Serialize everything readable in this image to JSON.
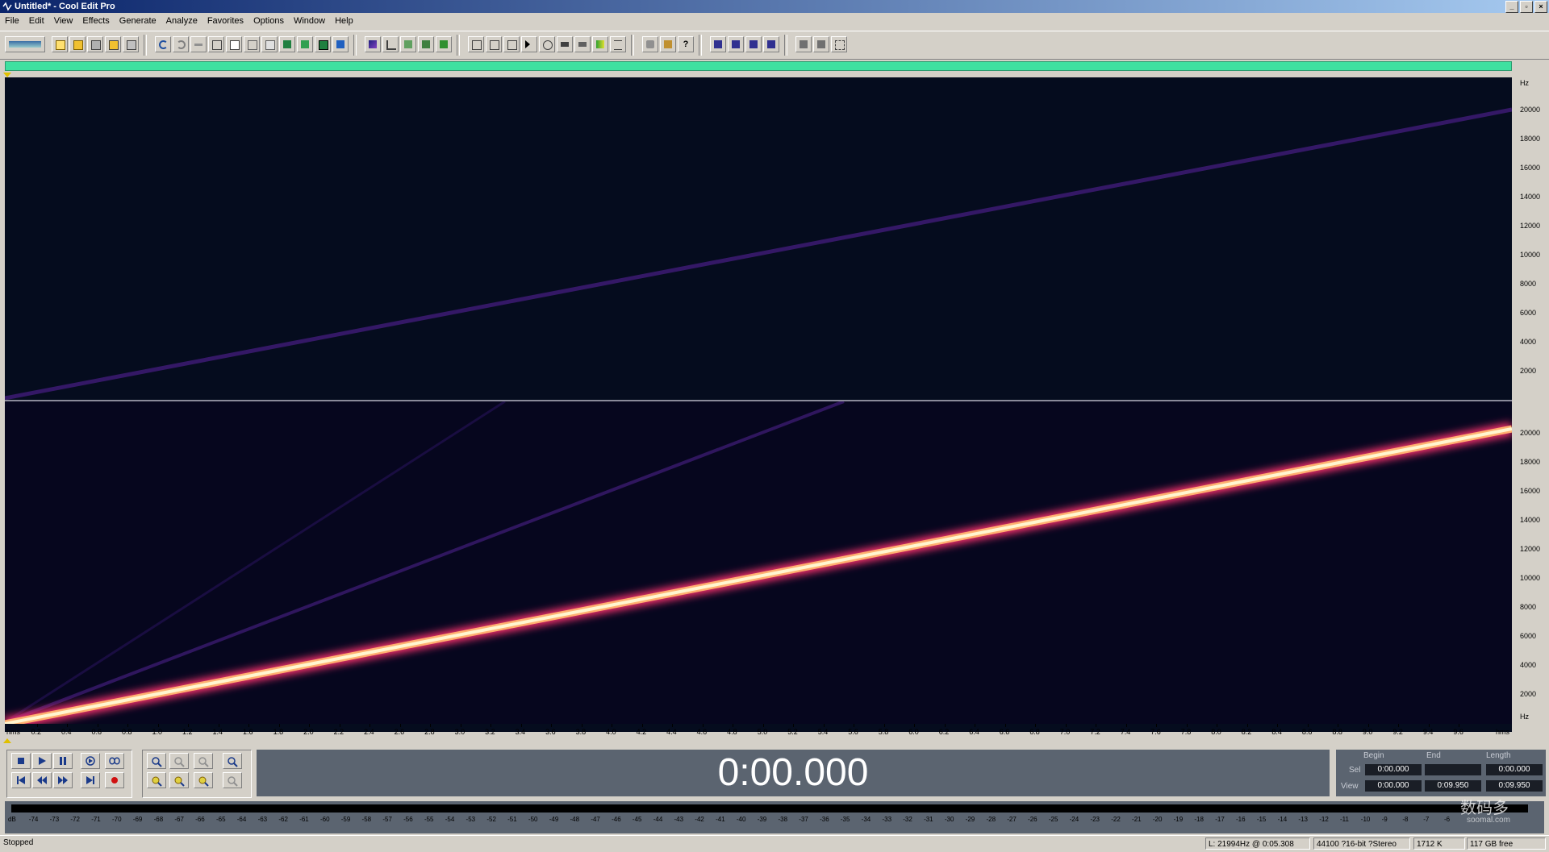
{
  "window": {
    "title": "Untitled* - Cool Edit Pro",
    "buttons": [
      "_",
      "▫",
      "×"
    ]
  },
  "menu": [
    "File",
    "Edit",
    "View",
    "Effects",
    "Generate",
    "Analyze",
    "Favorites",
    "Options",
    "Window",
    "Help"
  ],
  "freq_ruler": {
    "top": {
      "unit": "Hz",
      "labels": [
        "20000",
        "18000",
        "16000",
        "14000",
        "12000",
        "10000",
        "8000",
        "6000",
        "4000",
        "2000"
      ]
    },
    "bottom": {
      "unit": "Hz",
      "labels": [
        "20000",
        "18000",
        "16000",
        "14000",
        "12000",
        "10000",
        "8000",
        "6000",
        "4000",
        "2000"
      ]
    }
  },
  "time_ruler": {
    "start_label": "hms",
    "end_label": "hms",
    "labels": [
      "0.2",
      "0.4",
      "0.6",
      "0.8",
      "1.0",
      "1.2",
      "1.4",
      "1.6",
      "1.8",
      "2.0",
      "2.2",
      "2.4",
      "2.6",
      "2.8",
      "3.0",
      "3.2",
      "3.4",
      "3.6",
      "3.8",
      "4.0",
      "4.2",
      "4.4",
      "4.6",
      "4.8",
      "5.0",
      "5.2",
      "5.4",
      "5.6",
      "5.8",
      "6.0",
      "6.2",
      "6.4",
      "6.6",
      "6.8",
      "7.0",
      "7.2",
      "7.4",
      "7.6",
      "7.8",
      "8.0",
      "8.2",
      "8.4",
      "8.6",
      "8.8",
      "9.0",
      "9.2",
      "9.4",
      "9.6"
    ]
  },
  "spectrogram": {
    "top_channel": {
      "sweep_start_hz": 0,
      "sweep_end_hz": 20000,
      "color": "#3a1a6e"
    },
    "bottom_channel": {
      "sweep_start_hz": 0,
      "sweep_end_hz": 20000,
      "core_color": "#fff6d0",
      "glow_color": "#ff4a7a",
      "harmonic_color": "#3a1a6e"
    }
  },
  "time_display": "0:00.000",
  "selection": {
    "headers": {
      "begin": "Begin",
      "end": "End",
      "length": "Length"
    },
    "sel": {
      "label": "Sel",
      "begin": "0:00.000",
      "end": "",
      "length": "0:00.000"
    },
    "view": {
      "label": "View",
      "begin": "0:00.000",
      "end": "0:09.950",
      "length": "0:09.950"
    }
  },
  "level_meter": {
    "labels": [
      "dB",
      "-74",
      "-73",
      "-72",
      "-71",
      "-70",
      "-69",
      "-68",
      "-67",
      "-66",
      "-65",
      "-64",
      "-63",
      "-62",
      "-61",
      "-60",
      "-59",
      "-58",
      "-57",
      "-56",
      "-55",
      "-54",
      "-53",
      "-52",
      "-51",
      "-50",
      "-49",
      "-48",
      "-47",
      "-46",
      "-45",
      "-44",
      "-43",
      "-42",
      "-41",
      "-40",
      "-39",
      "-38",
      "-37",
      "-36",
      "-35",
      "-34",
      "-33",
      "-32",
      "-31",
      "-30",
      "-29",
      "-28",
      "-27",
      "-26",
      "-25",
      "-24",
      "-23",
      "-22",
      "-21",
      "-20",
      "-19",
      "-18",
      "-17",
      "-16",
      "-15",
      "-14",
      "-13",
      "-12",
      "-11",
      "-10",
      "-9",
      "-8",
      "-7",
      "-6"
    ]
  },
  "status": {
    "state": "Stopped",
    "cursor": "L: 21994Hz @  0:05.308",
    "format": "44100 ?16-bit ?Stereo",
    "size": "1712 K",
    "free": "117 GB free"
  },
  "watermark": {
    "text": "数码多",
    "sub": "soomal.com"
  },
  "colors": {
    "spectro_bg": "#050c1e",
    "overview": "#3fe0a0",
    "display_bg": "#5b6470"
  }
}
